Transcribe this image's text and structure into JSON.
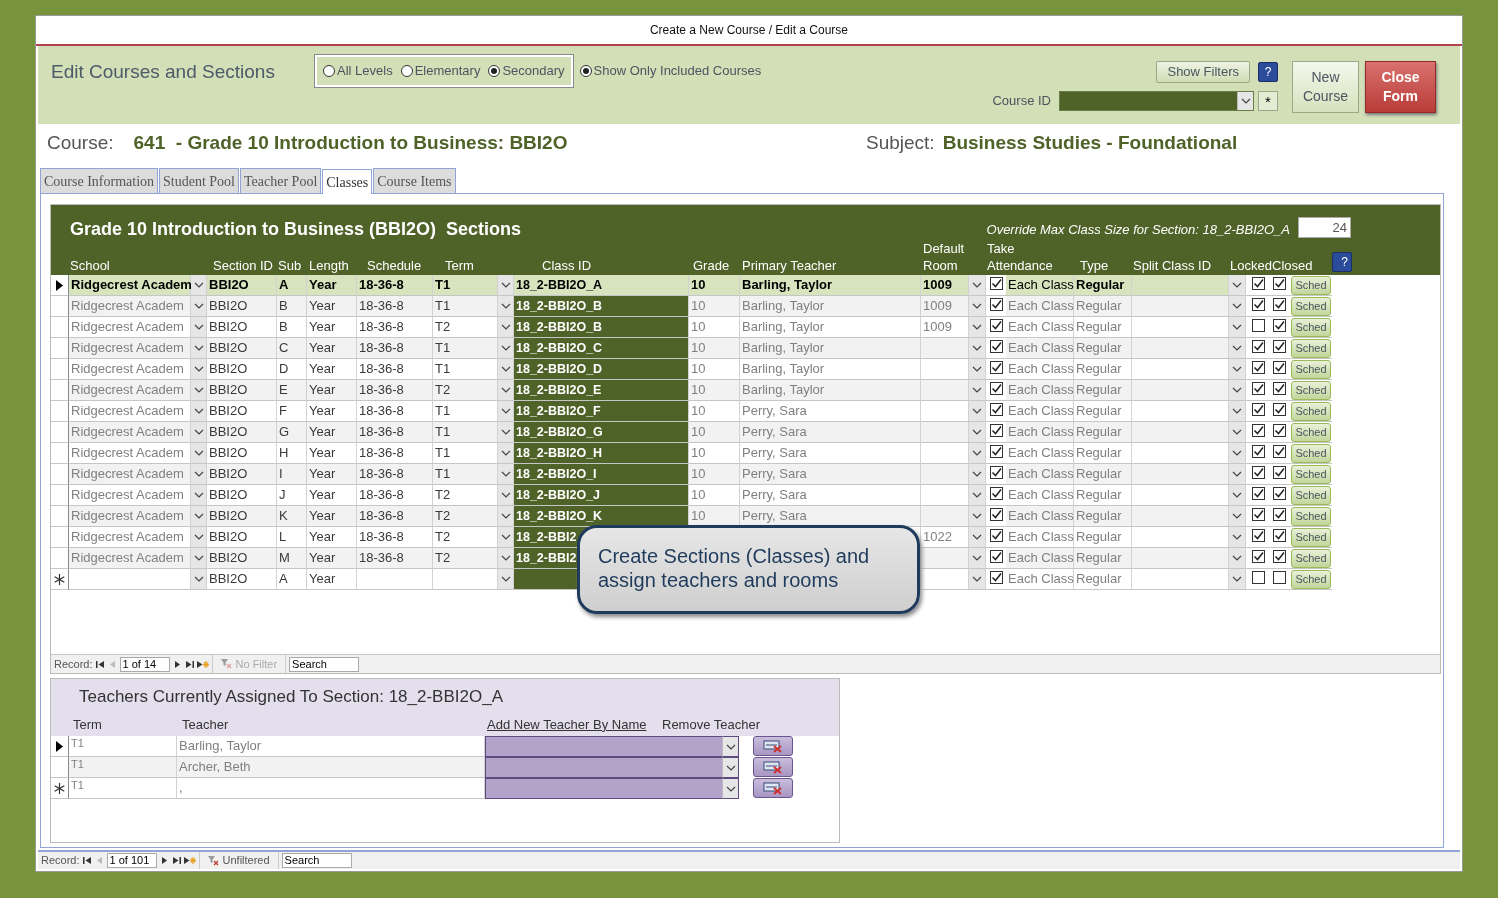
{
  "window": {
    "title": "Create a New Course / Edit a Course"
  },
  "header": {
    "title": "Edit Courses and Sections",
    "level_options": [
      {
        "label": "All Levels",
        "selected": false
      },
      {
        "label": "Elementary",
        "selected": false
      },
      {
        "label": "Secondary",
        "selected": true
      }
    ],
    "show_only_included": {
      "label": "Show Only Included Courses",
      "selected": true
    },
    "show_filters": "Show Filters",
    "help": "?",
    "course_id_label": "Course ID",
    "add_button": "*",
    "new_course": "New Course",
    "close_form": "Close Form"
  },
  "course": {
    "label": "Course:",
    "number": "641",
    "name": "- Grade 10 Introduction to Business: BBI2O",
    "subject_label": "Subject:",
    "subject": "Business Studies - Foundational"
  },
  "tabs": [
    {
      "label": "Course Information",
      "selected": false
    },
    {
      "label": "Student Pool",
      "selected": false
    },
    {
      "label": "Teacher Pool",
      "selected": false
    },
    {
      "label": "Classes",
      "selected": true
    },
    {
      "label": "Course Items",
      "selected": false
    }
  ],
  "sections": {
    "title": "Grade 10 Introduction to Business (BBI2O)  Sections",
    "override_label": "Override Max Class Size for Section: 18_2-BBI2O_A",
    "override_value": "24",
    "help": "?",
    "columns": [
      "School",
      "Section ID",
      "Sub",
      "Length",
      "Schedule",
      "Term",
      "Class ID",
      "Grade",
      "Primary Teacher",
      "Default Room",
      "Take Attendance",
      "Type",
      "Split Class ID",
      "Locked",
      "Closed"
    ],
    "rows": [
      {
        "kind": "record",
        "selected": true,
        "school": "Ridgecrest Academ",
        "section_id": "BBI2O",
        "sub": "A",
        "length": "Year",
        "schedule": "18-36-8",
        "term": "T1",
        "class_id": "18_2-BBI2O_A",
        "grade": "10",
        "teacher": "Barling, Taylor",
        "room": "1009",
        "take_attendance": true,
        "attendance": "Each Class",
        "type": "Regular",
        "locked": true,
        "closed": true,
        "sched": "Sched"
      },
      {
        "kind": "record",
        "selected": false,
        "school": "Ridgecrest Academ",
        "section_id": "BBI2O",
        "sub": "B",
        "length": "Year",
        "schedule": "18-36-8",
        "term": "T1",
        "class_id": "18_2-BBI2O_B",
        "grade": "10",
        "teacher": "Barling, Taylor",
        "room": "1009",
        "take_attendance": true,
        "attendance": "Each Class",
        "type": "Regular",
        "locked": true,
        "closed": true,
        "sched": "Sched"
      },
      {
        "kind": "record",
        "selected": false,
        "school": "Ridgecrest Academ",
        "section_id": "BBI2O",
        "sub": "B",
        "length": "Year",
        "schedule": "18-36-8",
        "term": "T2",
        "class_id": "18_2-BBI2O_B",
        "grade": "10",
        "teacher": "Barling, Taylor",
        "room": "1009",
        "take_attendance": true,
        "attendance": "Each Class",
        "type": "Regular",
        "locked": false,
        "closed": true,
        "sched": "Sched"
      },
      {
        "kind": "record",
        "selected": false,
        "school": "Ridgecrest Academ",
        "section_id": "BBI2O",
        "sub": "C",
        "length": "Year",
        "schedule": "18-36-8",
        "term": "T1",
        "class_id": "18_2-BBI2O_C",
        "grade": "10",
        "teacher": "Barling, Taylor",
        "take_attendance": true,
        "attendance": "Each Class",
        "type": "Regular",
        "locked": true,
        "closed": true,
        "sched": "Sched"
      },
      {
        "kind": "record",
        "selected": false,
        "school": "Ridgecrest Academ",
        "section_id": "BBI2O",
        "sub": "D",
        "length": "Year",
        "schedule": "18-36-8",
        "term": "T1",
        "class_id": "18_2-BBI2O_D",
        "grade": "10",
        "teacher": "Barling, Taylor",
        "take_attendance": true,
        "attendance": "Each Class",
        "type": "Regular",
        "locked": true,
        "closed": true,
        "sched": "Sched"
      },
      {
        "kind": "record",
        "selected": false,
        "school": "Ridgecrest Academ",
        "section_id": "BBI2O",
        "sub": "E",
        "length": "Year",
        "schedule": "18-36-8",
        "term": "T2",
        "class_id": "18_2-BBI2O_E",
        "grade": "10",
        "teacher": "Barling, Taylor",
        "take_attendance": true,
        "attendance": "Each Class",
        "type": "Regular",
        "locked": true,
        "closed": true,
        "sched": "Sched"
      },
      {
        "kind": "record",
        "selected": false,
        "school": "Ridgecrest Academ",
        "section_id": "BBI2O",
        "sub": "F",
        "length": "Year",
        "schedule": "18-36-8",
        "term": "T1",
        "class_id": "18_2-BBI2O_F",
        "grade": "10",
        "teacher": "Perry, Sara",
        "take_attendance": true,
        "attendance": "Each Class",
        "type": "Regular",
        "locked": true,
        "closed": true,
        "sched": "Sched"
      },
      {
        "kind": "record",
        "selected": false,
        "school": "Ridgecrest Academ",
        "section_id": "BBI2O",
        "sub": "G",
        "length": "Year",
        "schedule": "18-36-8",
        "term": "T1",
        "class_id": "18_2-BBI2O_G",
        "grade": "10",
        "teacher": "Perry, Sara",
        "take_attendance": true,
        "attendance": "Each Class",
        "type": "Regular",
        "locked": true,
        "closed": true,
        "sched": "Sched"
      },
      {
        "kind": "record",
        "selected": false,
        "school": "Ridgecrest Academ",
        "section_id": "BBI2O",
        "sub": "H",
        "length": "Year",
        "schedule": "18-36-8",
        "term": "T1",
        "class_id": "18_2-BBI2O_H",
        "grade": "10",
        "teacher": "Perry, Sara",
        "take_attendance": true,
        "attendance": "Each Class",
        "type": "Regular",
        "locked": true,
        "closed": true,
        "sched": "Sched"
      },
      {
        "kind": "record",
        "selected": false,
        "school": "Ridgecrest Academ",
        "section_id": "BBI2O",
        "sub": "I",
        "length": "Year",
        "schedule": "18-36-8",
        "term": "T1",
        "class_id": "18_2-BBI2O_I",
        "grade": "10",
        "teacher": "Perry, Sara",
        "take_attendance": true,
        "attendance": "Each Class",
        "type": "Regular",
        "locked": true,
        "closed": true,
        "sched": "Sched"
      },
      {
        "kind": "record",
        "selected": false,
        "school": "Ridgecrest Academ",
        "section_id": "BBI2O",
        "sub": "J",
        "length": "Year",
        "schedule": "18-36-8",
        "term": "T2",
        "class_id": "18_2-BBI2O_J",
        "grade": "10",
        "teacher": "Perry, Sara",
        "take_attendance": true,
        "attendance": "Each Class",
        "type": "Regular",
        "locked": true,
        "closed": true,
        "sched": "Sched"
      },
      {
        "kind": "record",
        "selected": false,
        "school": "Ridgecrest Academ",
        "section_id": "BBI2O",
        "sub": "K",
        "length": "Year",
        "schedule": "18-36-8",
        "term": "T2",
        "class_id": "18_2-BBI2O_K",
        "grade": "10",
        "teacher": "Perry, Sara",
        "take_attendance": true,
        "attendance": "Each Class",
        "type": "Regular",
        "locked": true,
        "closed": true,
        "sched": "Sched"
      },
      {
        "kind": "record",
        "selected": false,
        "school": "Ridgecrest Academ",
        "section_id": "BBI2O",
        "sub": "L",
        "length": "Year",
        "schedule": "18-36-8",
        "term": "T2",
        "class_id": "18_2-BBI2",
        "room": "1022",
        "take_attendance": true,
        "attendance": "Each Class",
        "type": "Regular",
        "locked": true,
        "closed": true,
        "sched": "Sched"
      },
      {
        "kind": "record",
        "selected": false,
        "school": "Ridgecrest Academ",
        "section_id": "BBI2O",
        "sub": "M",
        "length": "Year",
        "schedule": "18-36-8",
        "term": "T2",
        "class_id": "18_2-BBI2",
        "take_attendance": true,
        "attendance": "Each Class",
        "type": "Regular",
        "locked": true,
        "closed": true,
        "sched": "Sched"
      },
      {
        "kind": "new_record",
        "selected": false,
        "section_id": "BBI2O",
        "sub": "A",
        "length": "Year",
        "take_attendance": true,
        "attendance": "Each Class",
        "type": "Regular",
        "locked": false,
        "closed": false,
        "sched": "Sched"
      }
    ],
    "nav": {
      "label": "Record:",
      "position": "1 of 14",
      "filter": "No Filter",
      "filter_disabled": true,
      "search": "Search"
    }
  },
  "callout": "Create Sections (Classes) and assign teachers and rooms",
  "teachers": {
    "title": "Teachers Currently Assigned To Section: 18_2-BBI2O_A",
    "columns": [
      "Term",
      "Teacher",
      "Add New Teacher By Name",
      "Remove Teacher"
    ],
    "rows": [
      {
        "kind": "record",
        "selected": true,
        "term": "T1",
        "teacher": "Barling, Taylor"
      },
      {
        "kind": "record",
        "selected": false,
        "term": "T1",
        "teacher": "Archer, Beth"
      },
      {
        "kind": "new_record",
        "selected": false,
        "term": "T1",
        "teacher": ","
      }
    ]
  },
  "nav": {
    "label": "Record:",
    "position": "1 of 101",
    "filter": "Unfiltered",
    "filter_disabled": false,
    "search": "Search"
  }
}
